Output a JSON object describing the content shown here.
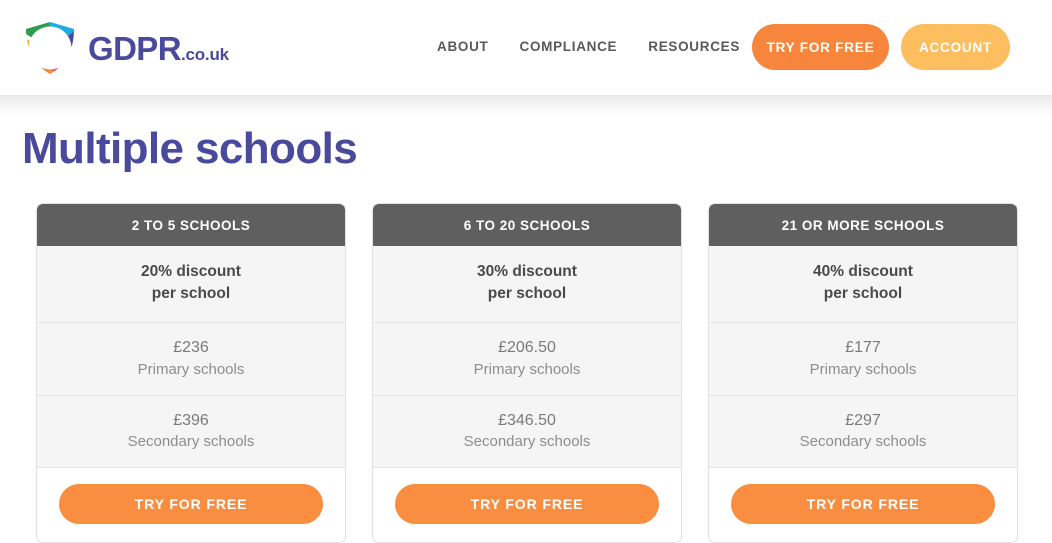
{
  "brand": {
    "logo_icon": "gdpr-shield-logo-icon",
    "name_main": "GDPR",
    "name_tld": ".co.uk",
    "color": "#4a4a9c",
    "logo_colors": {
      "green": "#2e9b4f",
      "blue": "#1eaae4",
      "indigo": "#4a4a9c",
      "red": "#ef5350",
      "orange": "#f7863c",
      "amber": "#fbb040"
    }
  },
  "header": {
    "nav": [
      {
        "label": "ABOUT"
      },
      {
        "label": "COMPLIANCE"
      },
      {
        "label": "RESOURCES"
      }
    ],
    "actions": {
      "try_label": "TRY FOR FREE",
      "try_color": "#f7863c",
      "account_label": "ACCOUNT",
      "account_color": "#fcbe5e"
    },
    "ghost_panels": {
      "label": "TRY FOR FREE",
      "panel_color": "#fdf7f2",
      "text_color": "#fffdfb"
    }
  },
  "main": {
    "title": "Multiple schools",
    "cta_label": "TRY FOR FREE",
    "cta_color": "#f98e41",
    "card_head_color": "#5f5f5f",
    "cards": [
      {
        "tier": "2 TO 5 SCHOOLS",
        "discount": "20% discount",
        "discount_sub": "per school",
        "primary_price": "£236",
        "primary_label": "Primary schools",
        "secondary_price": "£396",
        "secondary_label": "Secondary schools",
        "cta": "TRY FOR FREE"
      },
      {
        "tier": "6 TO 20 SCHOOLS",
        "discount": "30% discount",
        "discount_sub": "per school",
        "primary_price": "£206.50",
        "primary_label": "Primary schools",
        "secondary_price": "£346.50",
        "secondary_label": "Secondary schools",
        "cta": "TRY FOR FREE"
      },
      {
        "tier": "21 OR MORE SCHOOLS",
        "discount": "40% discount",
        "discount_sub": "per school",
        "primary_price": "£177",
        "primary_label": "Primary schools",
        "secondary_price": "£297",
        "secondary_label": "Secondary schools",
        "cta": "TRY FOR FREE"
      }
    ]
  }
}
